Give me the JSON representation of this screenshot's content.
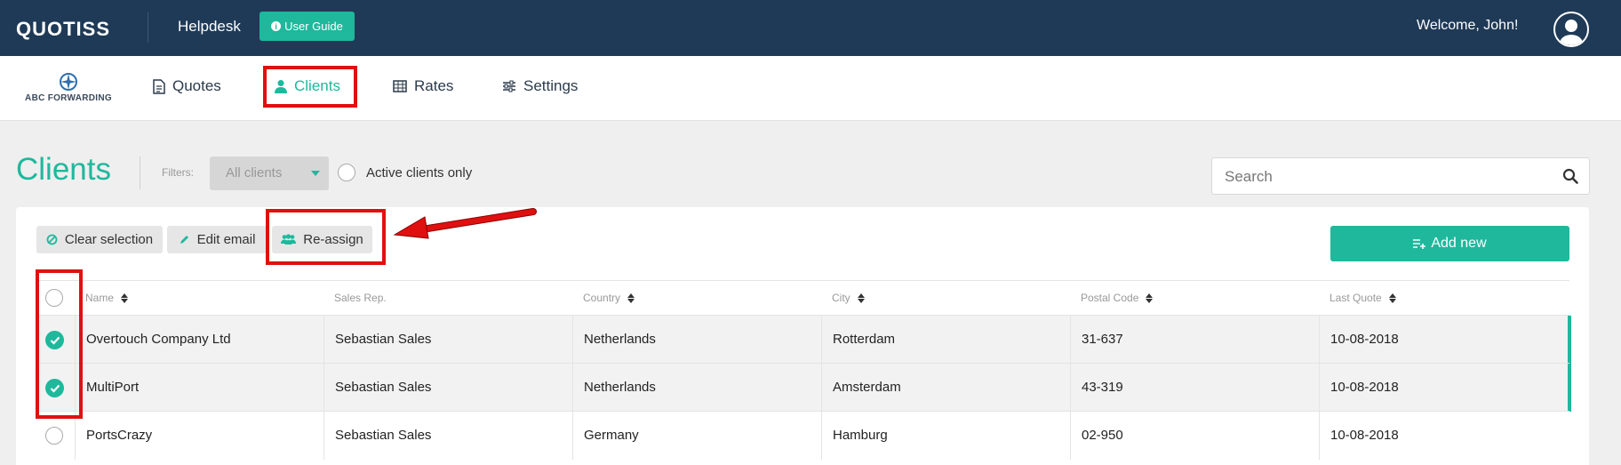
{
  "topbar": {
    "logo": "QUOTISS",
    "helpdesk": "Helpdesk",
    "user_guide": "User Guide",
    "welcome": "Welcome, John!"
  },
  "nav": {
    "brand": "ABC FORWARDING",
    "items": [
      {
        "label": "Quotes",
        "icon": "document-icon"
      },
      {
        "label": "Clients",
        "icon": "person-icon",
        "active": true
      },
      {
        "label": "Rates",
        "icon": "table-icon"
      },
      {
        "label": "Settings",
        "icon": "sliders-icon"
      }
    ]
  },
  "page": {
    "title": "Clients",
    "filters_label": "Filters:",
    "filter_value": "All clients",
    "active_only_label": "Active clients only",
    "search_placeholder": "Search"
  },
  "actions": {
    "clear_selection": "Clear selection",
    "edit_email": "Edit email",
    "reassign": "Re-assign",
    "add_new": "Add new"
  },
  "table": {
    "columns": [
      "Name",
      "Sales Rep.",
      "Country",
      "City",
      "Postal Code",
      "Last Quote"
    ],
    "rows": [
      {
        "selected": true,
        "cells": [
          "Overtouch Company Ltd",
          "Sebastian Sales",
          "Netherlands",
          "Rotterdam",
          "31-637",
          "10-08-2018"
        ]
      },
      {
        "selected": true,
        "cells": [
          "MultiPort",
          "Sebastian Sales",
          "Netherlands",
          "Amsterdam",
          "43-319",
          "10-08-2018"
        ]
      },
      {
        "selected": false,
        "cells": [
          "PortsCrazy",
          "Sebastian Sales",
          "Germany",
          "Hamburg",
          "02-950",
          "10-08-2018"
        ]
      }
    ]
  },
  "colors": {
    "accent": "#1fb89c",
    "topbar": "#1f3a57",
    "highlight": "#e01010"
  }
}
